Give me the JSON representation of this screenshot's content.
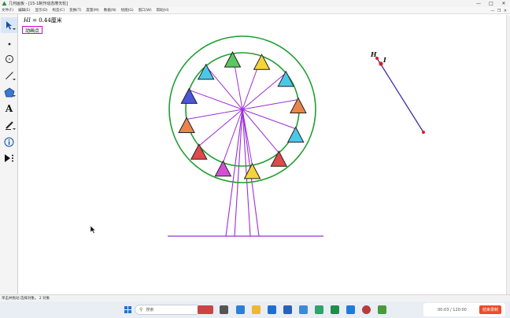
{
  "window": {
    "title": "几何画板 - [15-1制作动态摩天轮]",
    "controls": {
      "minimize": "—",
      "maximize": "□",
      "close": "✕"
    }
  },
  "menu": {
    "items": [
      "文件(F)",
      "编辑(E)",
      "显示(D)",
      "构造(C)",
      "变换(T)",
      "度量(M)",
      "数据(N)",
      "绘图(G)",
      "窗口(W)",
      "帮助(H)"
    ],
    "controls": {
      "minimize": "—",
      "restore": "❐",
      "close": "✕"
    }
  },
  "canvas": {
    "measure_var": "HI",
    "measure_value": " = 0.44",
    "measure_unit": "厘米",
    "animate_button": "动画点",
    "labels": {
      "point_h": "H",
      "point_i": "I"
    }
  },
  "colors": {
    "wheel_ring": "#1f9e2f",
    "spokes": "#9b2fd6",
    "segment": "#3d2db0",
    "point": "#d82020",
    "anim_border": "#d000d0",
    "record_button": "#f04a2a"
  },
  "cabins": [
    "#f5d33a",
    "#4bc7e8",
    "#e8864a",
    "#4bc7e8",
    "#e04a4a",
    "#f5d33a",
    "#d54fd6",
    "#e04a4a",
    "#e8864a",
    "#4a55d9",
    "#4bc7e8",
    "#59c860"
  ],
  "status": {
    "text": "单击并拖动 选择对象。  2 对象"
  },
  "taskbar": {
    "search_placeholder": "搜索",
    "record_time": "00:03 / 120:00",
    "record_button": "结束录制"
  }
}
